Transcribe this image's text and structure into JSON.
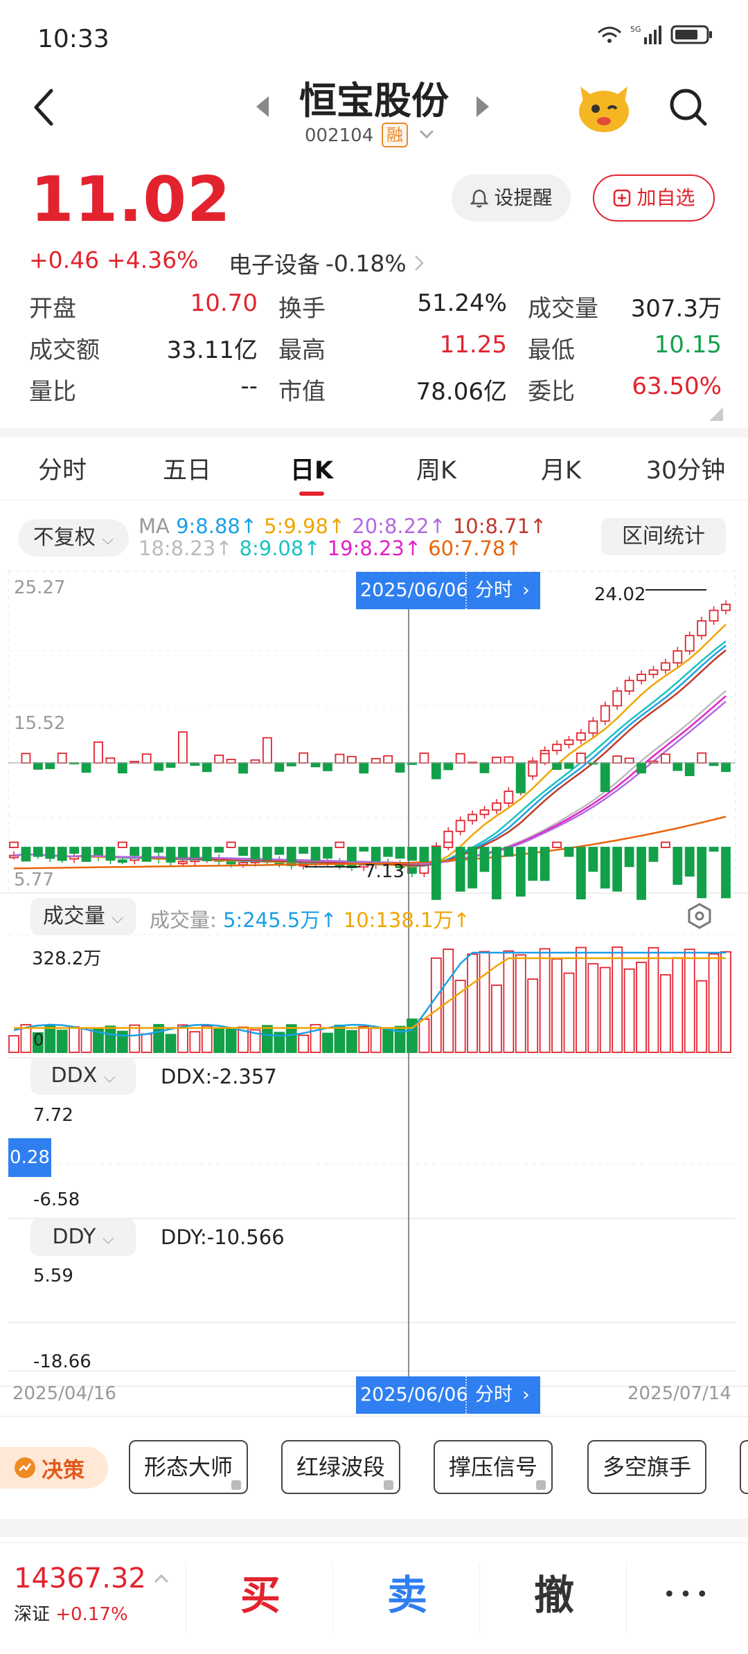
{
  "status_bar": {
    "time": "10:33"
  },
  "header": {
    "stock_name": "恒宝股份",
    "stock_code": "002104",
    "margin_badge": "融"
  },
  "quote": {
    "price": "11.02",
    "change": "+0.46",
    "change_pct": "+4.36%",
    "sector": "电子设备",
    "sector_change": "-0.18%",
    "remind_label": "设提醒",
    "add_watch_label": "加自选",
    "stats": [
      [
        {
          "label": "开盘",
          "value": "10.70",
          "color": "red"
        },
        {
          "label": "换手",
          "value": "51.24%",
          "color": "black"
        },
        {
          "label": "成交量",
          "value": "307.3万",
          "color": "black"
        }
      ],
      [
        {
          "label": "成交额",
          "value": "33.11亿",
          "color": "black"
        },
        {
          "label": "最高",
          "value": "11.25",
          "color": "red"
        },
        {
          "label": "最低",
          "value": "10.15",
          "color": "green"
        }
      ],
      [
        {
          "label": "量比",
          "value": "--",
          "color": "black"
        },
        {
          "label": "市值",
          "value": "78.06亿",
          "color": "black"
        },
        {
          "label": "委比",
          "value": "63.50%",
          "color": "red"
        }
      ]
    ]
  },
  "tabs": [
    "分时",
    "五日",
    "日K",
    "周K",
    "月K",
    "30分钟"
  ],
  "active_tab": "日K",
  "kline": {
    "adjust_label": "不复权",
    "range_stat_label": "区间统计",
    "ma_label": "MA",
    "ma_row1": [
      {
        "text": "9:8.88↑",
        "color": "#1aa0e6"
      },
      {
        "text": "5:9.98↑",
        "color": "#f0a500"
      },
      {
        "text": "20:8.22↑",
        "color": "#b16be0"
      },
      {
        "text": "10:8.71↑",
        "color": "#c0392b"
      }
    ],
    "ma_row2": [
      {
        "text": "18:8.23↑",
        "color": "#bbbbbb"
      },
      {
        "text": "8:9.08↑",
        "color": "#18c2c2"
      },
      {
        "text": "19:8.23↑",
        "color": "#e022c8"
      },
      {
        "text": "60:7.78↑",
        "color": "#e8650a"
      }
    ],
    "y_max": "25.27",
    "y_mid": "15.52",
    "y_min": "5.77",
    "high_label": "24.02",
    "low_label": "7.13",
    "cursor_date": "2025/06/06",
    "cursor_link": "分时",
    "start_date": "2025/04/16",
    "end_date": "2025/07/14"
  },
  "volume": {
    "selector": "成交量",
    "label": "成交量:",
    "ma5": "5:245.5万↑",
    "ma10": "10:138.1万↑",
    "y_max": "328.2万",
    "y_min": "0"
  },
  "ddx": {
    "selector": "DDX",
    "value_label": "DDX:-2.357",
    "y_max": "7.72",
    "y_min": "-6.58",
    "cursor_value": "0.28"
  },
  "ddy": {
    "selector": "DDY",
    "value_label": "DDY:-10.566",
    "y_max": "5.59",
    "y_min": "-18.66"
  },
  "strategy": {
    "badge": "决策",
    "buttons": [
      "形态大师",
      "红绿波段",
      "撑压信号",
      "多空旗手"
    ]
  },
  "bottom": {
    "index_value": "14367.32",
    "index_name": "深证",
    "index_change": "+0.17%",
    "buy": "买",
    "sell": "卖",
    "cancel": "撤",
    "more": "•••"
  },
  "colors": {
    "up": "#e2232e",
    "down": "#12a049",
    "accent": "#2f7ff0"
  }
}
